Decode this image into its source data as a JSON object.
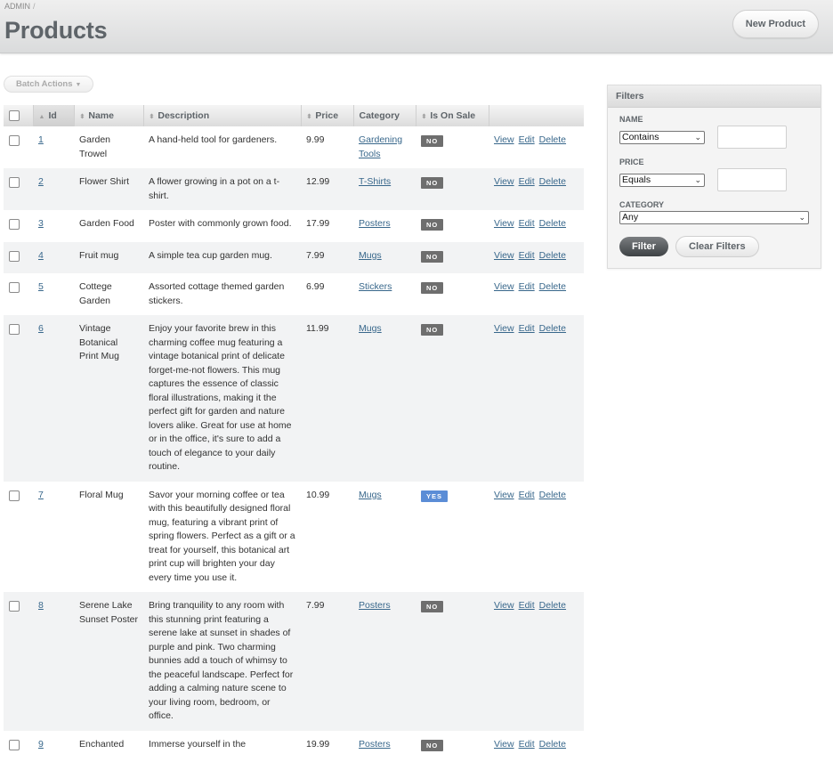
{
  "header": {
    "breadcrumb": "ADMIN",
    "breadcrumb_sep": "/",
    "title": "Products",
    "new_button": "New Product"
  },
  "batch_actions": "Batch Actions",
  "table": {
    "columns": [
      "Id",
      "Name",
      "Description",
      "Price",
      "Category",
      "Is On Sale"
    ],
    "row_actions": [
      "View",
      "Edit",
      "Delete"
    ],
    "rows": [
      {
        "id": "1",
        "name": "Garden Trowel",
        "description": "A hand-held tool for gardeners.",
        "price": "9.99",
        "category": "Gardening Tools",
        "on_sale": "NO"
      },
      {
        "id": "2",
        "name": "Flower Shirt",
        "description": "A flower growing in a pot on a t-shirt.",
        "price": "12.99",
        "category": "T-Shirts",
        "on_sale": "NO"
      },
      {
        "id": "3",
        "name": "Garden Food",
        "description": "Poster with commonly grown food.",
        "price": "17.99",
        "category": "Posters",
        "on_sale": "NO"
      },
      {
        "id": "4",
        "name": "Fruit mug",
        "description": "A simple tea cup garden mug.",
        "price": "7.99",
        "category": "Mugs",
        "on_sale": "NO"
      },
      {
        "id": "5",
        "name": "Cottege Garden",
        "description": "Assorted cottage themed garden stickers.",
        "price": "6.99",
        "category": "Stickers",
        "on_sale": "NO"
      },
      {
        "id": "6",
        "name": "Vintage Botanical Print Mug",
        "description": "Enjoy your favorite brew in this charming coffee mug featuring a vintage botanical print of delicate forget-me-not flowers. This mug captures the essence of classic floral illustrations, making it the perfect gift for garden and nature lovers alike. Great for use at home or in the office, it's sure to add a touch of elegance to your daily routine.",
        "price": "11.99",
        "category": "Mugs",
        "on_sale": "NO"
      },
      {
        "id": "7",
        "name": "Floral Mug",
        "description": "Savor your morning coffee or tea with this beautifully designed floral mug, featuring a vibrant print of spring flowers. Perfect as a gift or a treat for yourself, this botanical art print cup will brighten your day every time you use it.",
        "price": "10.99",
        "category": "Mugs",
        "on_sale": "YES"
      },
      {
        "id": "8",
        "name": "Serene Lake Sunset Poster",
        "description": "Bring tranquility to any room with this stunning print featuring a serene lake at sunset in shades of purple and pink. Two charming bunnies add a touch of whimsy to the peaceful landscape. Perfect for adding a calming nature scene to your living room, bedroom, or office.",
        "price": "7.99",
        "category": "Posters",
        "on_sale": "NO"
      },
      {
        "id": "9",
        "name": "Enchanted",
        "description": "Immerse yourself in the",
        "price": "19.99",
        "category": "Posters",
        "on_sale": "NO"
      }
    ]
  },
  "filters": {
    "title": "Filters",
    "name_label": "NAME",
    "name_op": "Contains",
    "price_label": "PRICE",
    "price_op": "Equals",
    "category_label": "CATEGORY",
    "category_value": "Any",
    "filter_button": "Filter",
    "clear_button": "Clear Filters"
  },
  "colors": {
    "link": "#38678b",
    "sale_yes": "#5b8dd6",
    "sale_no": "#6e6e6e"
  }
}
